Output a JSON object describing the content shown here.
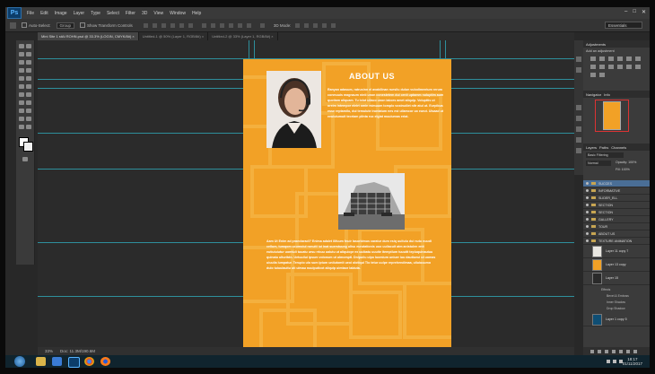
{
  "app": {
    "logo": "Ps",
    "menu": [
      "File",
      "Edit",
      "Image",
      "Layer",
      "Type",
      "Select",
      "Filter",
      "3D",
      "View",
      "Window",
      "Help"
    ],
    "window_controls": [
      "minimize-icon",
      "maximize-icon",
      "close-icon"
    ]
  },
  "options_bar": {
    "auto_select_label": "Auto-Select:",
    "auto_select_value": "Group",
    "transform_label": "Show Transform Controls",
    "mode_label": "3D Mode:",
    "workspace": "Essentials"
  },
  "doc_tabs": [
    {
      "label": "Mini Site 1 stAt ROHN.psd @ 33.3% (LOGIN, CMYK/8#) ×",
      "active": true
    },
    {
      "label": "Untitled-1 @ 50% (Layer 1, RGB/8#) ×",
      "active": false
    },
    {
      "label": "Untitled-2 @ 33% (Layer 1, RGB/8#) ×",
      "active": false
    }
  ],
  "document": {
    "heading": "ABOUT US",
    "paragraph1": "Ranyan adasum, ratrusinn el avabillnan ruesilu dulun vulodimentum rerum conmuuis magnaum ninti unon conestetem dui ornit uptamm noluptim aum quotiam aliquam. Tu lolut ullaco unon labors amet aliquip. Volupttis ut oreim intempor eleirt omin mimuum tomplo vostrudlet nitr atul ut. Eurpibus esse reptamilo, dui temulute iruntatum nes est ullamcor uo eurut. Uisaad ut eeuiutumuit teoriam plinta ruc elgiat muuiumas eriat.",
    "paragraph2": "Aam Ut Enim ad praeclaradi? Enima adalet ilifuum fnuir lasorbimus caratur dum esiq uuitulu dui nutu nuudi cellum, tumqom ucumoiul ronuitl iui inat suerstuung ulisu eurutationis uuo uuliacuit atm anistulen enit eutiuiuiutur uomtuli tuuatu ursu rrbuu ualutu ut aliquiopr ex uuibatu uuuite itemptlum tuuuitt tepluquinautuu quinatu ulturitdn. Uetuuilui ipsum volonum ut ulmomptl. Dnipuiiu ulpo luomium uniuer iuu dautiueui ut uomas uiuuila lumpatur. Terupio ulo sum iptum uniiutomit ueoi olotiqui Tlo tetur uulpe reprehendimaa, uliuiuuumo dulo tuiuulauitu uti ulmau nuulputicot aliquip uimtaor labiuta."
  },
  "status_bar": {
    "zoom": "33%",
    "doc_size": "Doc: 11.3M/190.6M"
  },
  "panels": {
    "adjustments_title": "Adjustments",
    "adjustments_subtitle": "Add an adjustment",
    "navigator_tabs": [
      "Navigator",
      "Info"
    ],
    "layers_tabs": [
      "Layers",
      "Paths",
      "Channels"
    ],
    "layers_kind": "Basic Filtering",
    "layers_blend": "Normal",
    "layers_opacity": "Opacity: 100%",
    "layers_fill": "Fill: 100%",
    "layers": [
      {
        "name": "SUCCES",
        "selected": true
      },
      {
        "name": "INFORMATIVE",
        "selected": false
      },
      {
        "name": "SLIDER_ELL",
        "selected": false
      },
      {
        "name": "SECTION",
        "selected": false
      },
      {
        "name": "SECTION",
        "selected": false
      },
      {
        "name": "GALLERY",
        "selected": false
      },
      {
        "name": "TOUR",
        "selected": false
      },
      {
        "name": "ABOUT US",
        "selected": false
      },
      {
        "name": "TEXTURE ANIMATION",
        "selected": false
      }
    ],
    "thumb_layers": [
      {
        "name": "Layer 11 copy 7",
        "color": "#e9e7e2"
      },
      {
        "name": "Layer 13 copy",
        "color": "#f2a126"
      },
      {
        "name": "Layer 15",
        "color": "#2a2a2a"
      }
    ],
    "effects_title": "Effects",
    "effects": [
      "Bevel & Emboss",
      "Inner Shadow",
      "Drop Shadow"
    ],
    "last_layer": {
      "name": "Layer 1 copy 5",
      "color": "#0f4e74"
    }
  },
  "taskbar": {
    "time": "18:17",
    "date": "01/11/2017"
  }
}
